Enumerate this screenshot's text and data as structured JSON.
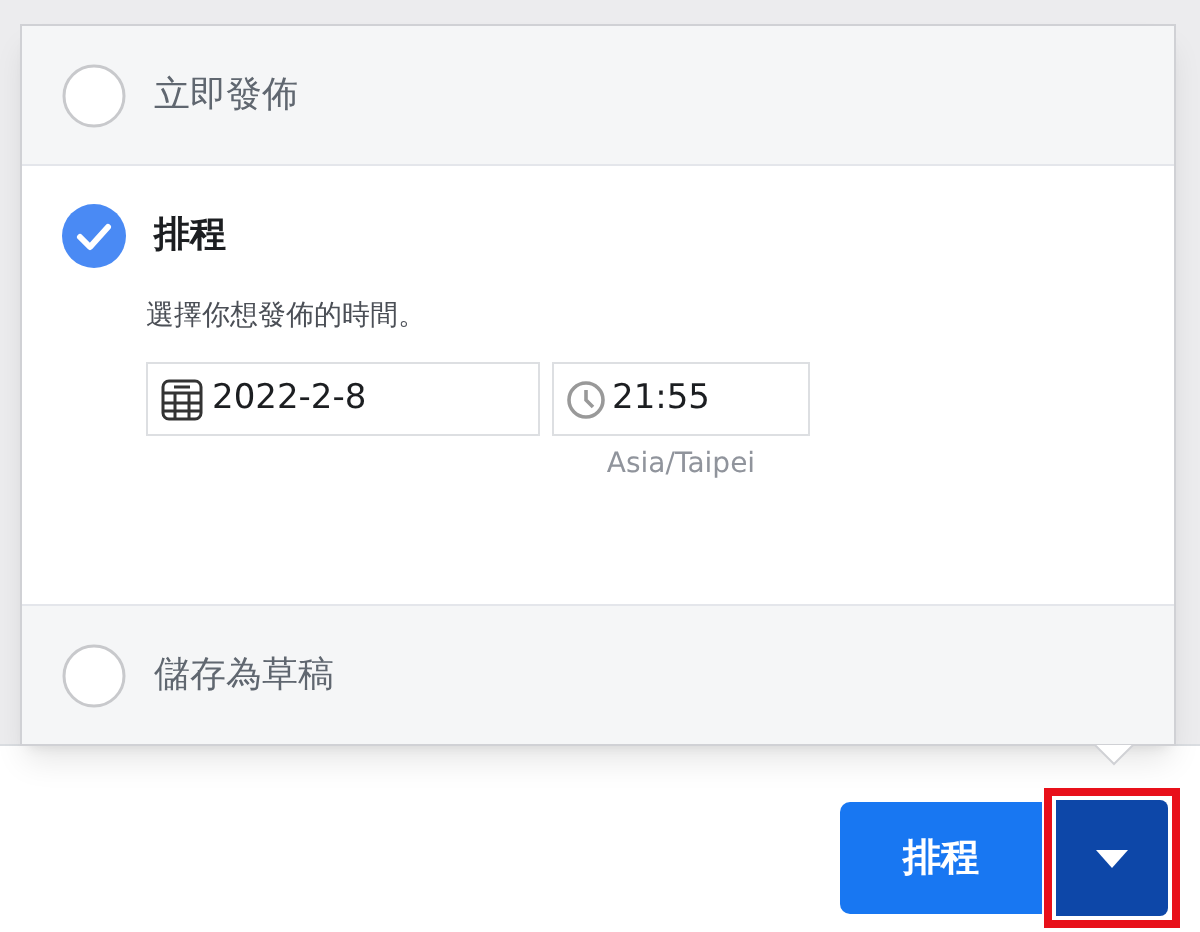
{
  "options": [
    {
      "label": "立即發佈",
      "selected": false
    },
    {
      "label": "排程",
      "selected": true,
      "description": "選擇你想發佈的時間。",
      "date": "2022-2-8",
      "time": "21:55",
      "timezone": "Asia/Taipei"
    },
    {
      "label": "儲存為草稿",
      "selected": false
    }
  ],
  "submit_button": {
    "label": "排程"
  },
  "dropdown_button": {
    "highlighted": true
  }
}
